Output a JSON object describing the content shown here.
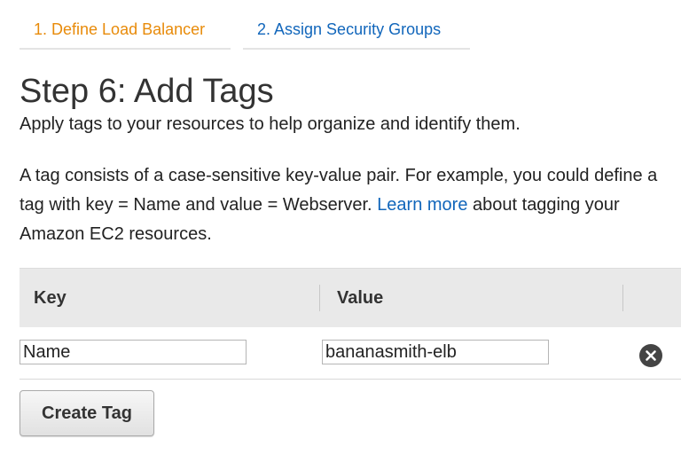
{
  "wizard_tabs": [
    {
      "label": "1. Define Load Balancer",
      "color": "#e88b0a"
    },
    {
      "label": "2. Assign Security Groups",
      "color": "#1166bb"
    }
  ],
  "page": {
    "title": "Step 6: Add Tags",
    "subtitle": "Apply tags to your resources to help organize and identify them.",
    "description_before_link": "A tag consists of a case-sensitive key-value pair. For example, you could define a tag with key = Name and value = Webserver. ",
    "learn_more_link": "Learn more",
    "description_after_link": " about tagging your Amazon EC2 resources."
  },
  "tags_table": {
    "columns": [
      "Key",
      "Value"
    ],
    "rows": [
      {
        "key": "Name",
        "value": "bananasmith-elb",
        "remove_icon": "close-circle-icon"
      }
    ]
  },
  "actions": {
    "create_tag_label": "Create Tag"
  }
}
